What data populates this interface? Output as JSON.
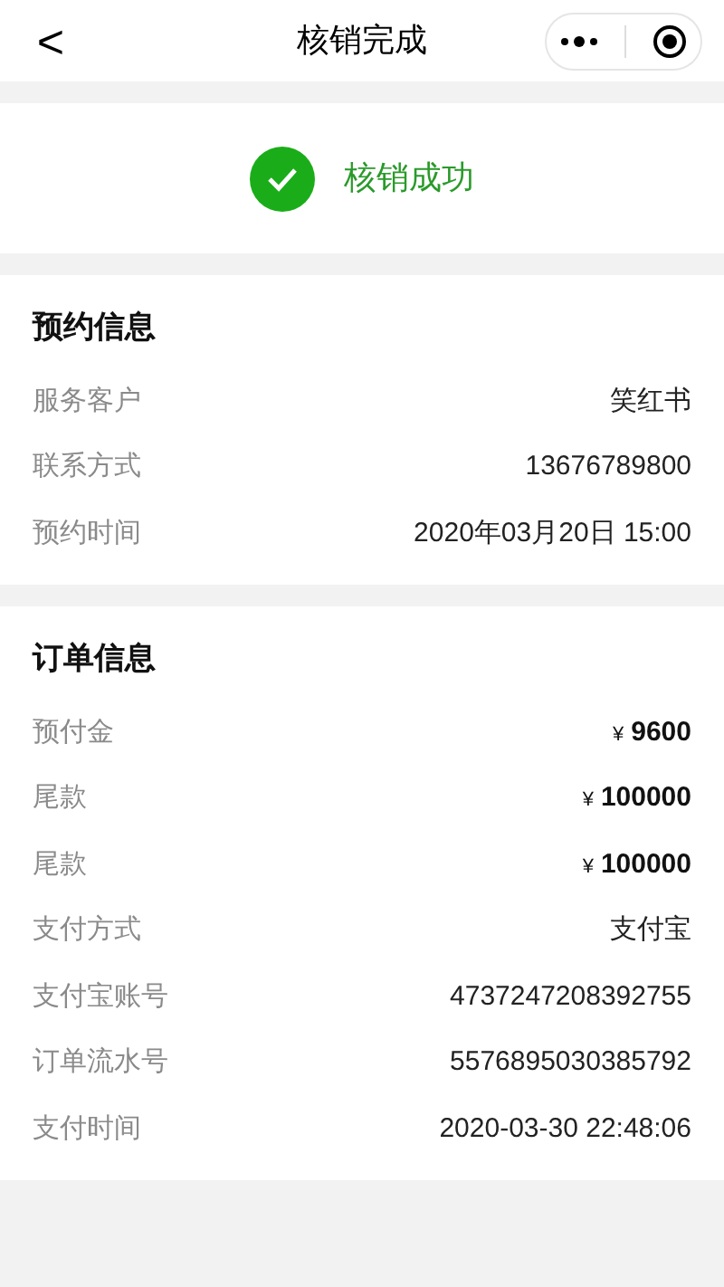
{
  "header": {
    "back": "<",
    "title": "核销完成"
  },
  "status": {
    "text": "核销成功"
  },
  "sections": [
    {
      "title": "预约信息",
      "rows": [
        {
          "kind": "text",
          "label": "服务客户",
          "value": "笑红书"
        },
        {
          "kind": "text",
          "label": "联系方式",
          "value": "13676789800"
        },
        {
          "kind": "text",
          "label": "预约时间",
          "value": "2020年03月20日 15:00"
        }
      ]
    },
    {
      "title": "订单信息",
      "rows": [
        {
          "kind": "amount",
          "label": "预付金",
          "currency": "¥",
          "value": "9600"
        },
        {
          "kind": "amount",
          "label": "尾款",
          "currency": "¥",
          "value": "100000"
        },
        {
          "kind": "amount",
          "label": "尾款",
          "currency": "¥",
          "value": "100000"
        },
        {
          "kind": "text",
          "label": "支付方式",
          "value": "支付宝"
        },
        {
          "kind": "text",
          "label": "支付宝账号",
          "value": "4737247208392755"
        },
        {
          "kind": "text",
          "label": "订单流水号",
          "value": "5576895030385792"
        },
        {
          "kind": "text",
          "label": "支付时间",
          "value": "2020-03-30 22:48:06"
        }
      ]
    }
  ]
}
